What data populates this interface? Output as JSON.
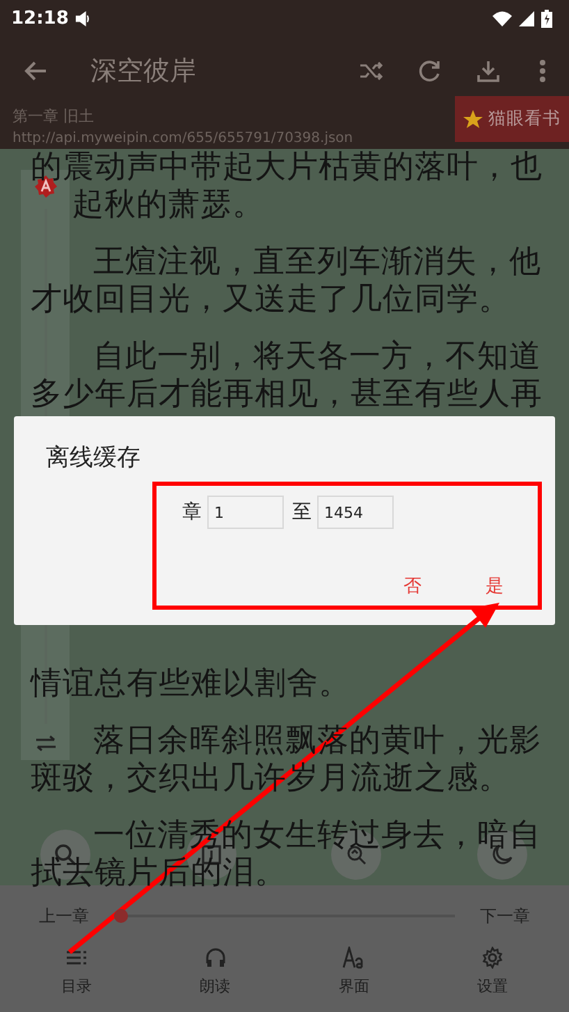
{
  "status_bar": {
    "time": "12:18"
  },
  "toolbar": {
    "title": "深空彼岸"
  },
  "chapter": {
    "title": "第一章 旧土",
    "url": "http://api.myweipin.com/655/655791/70398.json"
  },
  "source_badge": {
    "label": "猫眼看书"
  },
  "reading_text": {
    "lines_above": [
      {
        "text": "的震动声中带起大片枯黄的落叶，也",
        "kind": "wrap"
      },
      {
        "text": "起秋的萧瑟。",
        "kind": "partial"
      },
      {
        "text": "王煊注视，直至列车渐消失，他",
        "kind": "first"
      },
      {
        "text": "才收回目光，又送走了几位同学。",
        "kind": "wrap"
      },
      {
        "text": "自此一别，将天各一方，不知道",
        "kind": "first"
      },
      {
        "text": "多少年后才能再相见，甚至有些人再",
        "kind": "wrap"
      }
    ],
    "lines_below": [
      {
        "text": "情谊总有些难以割舍。",
        "kind": "wrap"
      },
      {
        "text": "落日余晖斜照飘落的黄叶，光影",
        "kind": "first"
      },
      {
        "text": "斑驳，交织出几许岁月流逝之感。",
        "kind": "wrap"
      },
      {
        "text": "一位清秀的女生转过身去，暗自",
        "kind": "first"
      },
      {
        "text": "拭去镜片后的泪。",
        "kind": "wrap"
      }
    ]
  },
  "dialog": {
    "title": "离线缓存",
    "from_label": "章",
    "from_value": "1",
    "to_label": "至",
    "to_value": "1454",
    "buttons": [
      "否",
      "是"
    ]
  },
  "floating_buttons": [
    {
      "kind": "search"
    },
    {
      "kind": "auto"
    },
    {
      "kind": "replace"
    },
    {
      "kind": "night"
    }
  ],
  "progress": {
    "prev_label": "上一章",
    "next_label": "下一章",
    "level": 0.02
  },
  "nav": [
    {
      "label": "目录",
      "kind": "contents"
    },
    {
      "label": "朗读",
      "kind": "listen"
    },
    {
      "label": "界面",
      "kind": "display"
    },
    {
      "label": "设置",
      "kind": "settings"
    }
  ]
}
